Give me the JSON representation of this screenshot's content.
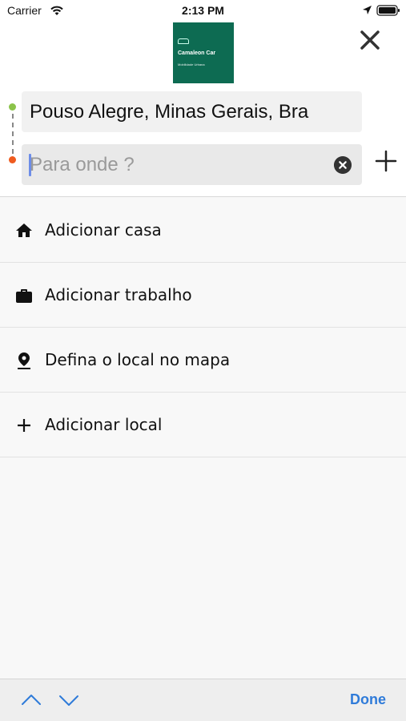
{
  "status_bar": {
    "carrier": "Carrier",
    "time": "2:13 PM",
    "icons": [
      "wifi-icon",
      "location-arrow-icon",
      "battery-icon"
    ]
  },
  "header": {
    "logo": {
      "title": "Camaleon Car",
      "subtitle": "Mobilidade Urbana",
      "background_color": "#0d6b52"
    },
    "close_icon": "close-icon"
  },
  "route": {
    "origin_value": "Pouso Alegre, Minas Gerais, Bra",
    "destination_value": "",
    "destination_placeholder": "Para onde ?",
    "start_dot_color": "#8bc34a",
    "end_dot_color": "#ef5b1f",
    "clear_icon": "clear-icon",
    "add_stop_icon": "plus-icon"
  },
  "menu": {
    "items": [
      {
        "label": "Adicionar casa",
        "icon": "home-icon"
      },
      {
        "label": "Adicionar trabalho",
        "icon": "briefcase-icon"
      },
      {
        "label": "Defina o local no mapa",
        "icon": "map-pin-icon"
      },
      {
        "label": "Adicionar local",
        "icon": "plus-icon"
      }
    ]
  },
  "keyboard_toolbar": {
    "done_label": "Done",
    "accent_color": "#2f7bd9",
    "prev_icon": "chevron-up-icon",
    "next_icon": "chevron-down-icon"
  }
}
